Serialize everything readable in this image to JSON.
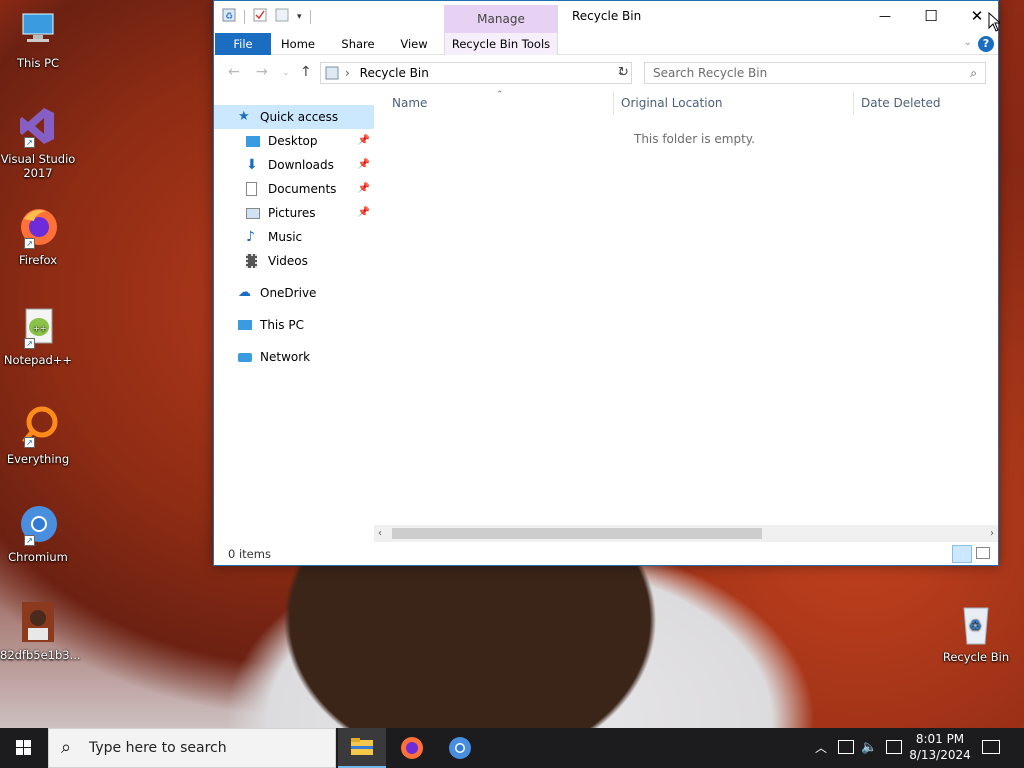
{
  "desktop": {
    "icons": [
      {
        "label": "This PC"
      },
      {
        "label": "Visual Studio 2017"
      },
      {
        "label": "Firefox"
      },
      {
        "label": "Notepad++"
      },
      {
        "label": "Everything"
      },
      {
        "label": "Chromium"
      },
      {
        "label": "82dfb5e1b3..."
      },
      {
        "label": "Recycle Bin"
      }
    ]
  },
  "window": {
    "title": "Recycle Bin",
    "context_tab": "Manage",
    "controls": {
      "minimize": "—",
      "maximize": "☐",
      "close": "✕"
    },
    "ribbon_tabs": [
      "File",
      "Home",
      "Share",
      "View",
      "Recycle Bin Tools"
    ],
    "help": "?",
    "address": {
      "path": "Recycle Bin"
    },
    "search": {
      "placeholder": "Search Recycle Bin"
    },
    "nav": {
      "quick_access": "Quick access",
      "pinned": [
        "Desktop",
        "Downloads",
        "Documents",
        "Pictures"
      ],
      "unpinned": [
        "Music",
        "Videos"
      ],
      "onedrive": "OneDrive",
      "this_pc": "This PC",
      "network": "Network"
    },
    "columns": [
      "Name",
      "Original Location",
      "Date Deleted"
    ],
    "empty_message": "This folder is empty.",
    "status": "0 items"
  },
  "taskbar": {
    "search_placeholder": "Type here to search",
    "time": "8:01 PM",
    "date": "8/13/2024"
  },
  "colors": {
    "accent": "#1a6dc0",
    "context_tab": "#e8d2f4",
    "selection": "#cce8ff",
    "taskbar": "#1c1c1e"
  }
}
